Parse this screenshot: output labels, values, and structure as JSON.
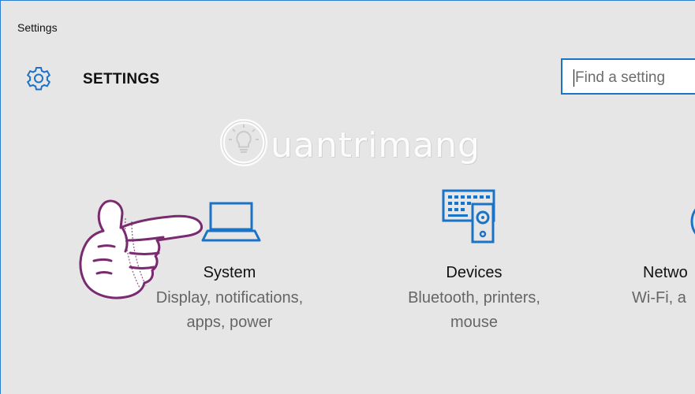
{
  "window": {
    "title": "Settings"
  },
  "header": {
    "title": "SETTINGS",
    "icon": "gear-icon"
  },
  "search": {
    "placeholder": "Find a setting",
    "value": ""
  },
  "watermark": {
    "text": "uantrimang"
  },
  "tiles": [
    {
      "name": "System",
      "desc_line1": "Display, notifications,",
      "desc_line2": "apps, power",
      "icon": "laptop-icon"
    },
    {
      "name": "Devices",
      "desc_line1": "Bluetooth, printers,",
      "desc_line2": "mouse",
      "icon": "devices-icon"
    },
    {
      "name": "Netwo",
      "desc_line1": "Wi-Fi, a",
      "desc_line2": "",
      "icon": "network-icon"
    }
  ],
  "colors": {
    "accent": "#1a73c7",
    "background": "#e6e6e6",
    "hand_outline": "#7a2a6e"
  }
}
